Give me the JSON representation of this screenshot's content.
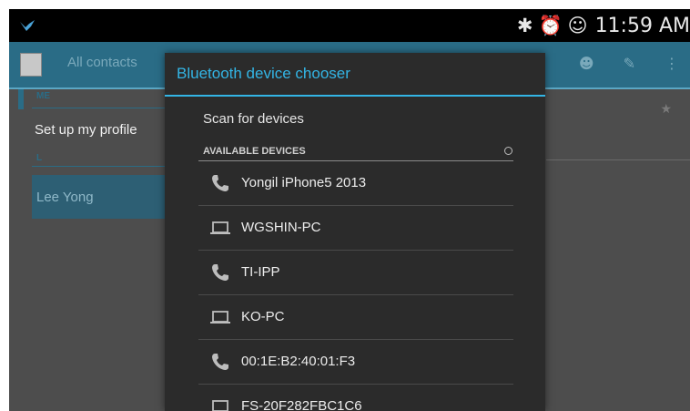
{
  "status_bar": {
    "logo_icon": "bird-logo-icon",
    "icons": [
      "bluetooth-icon",
      "alarm-icon",
      "account-sync-icon"
    ],
    "time": "11:59 AM"
  },
  "action_bar": {
    "title": "All contacts",
    "icons": [
      "contact-icon",
      "edit-icon",
      "overflow-menu-icon"
    ]
  },
  "contacts": {
    "section_me": "ME",
    "profile_label": "Set up my profile",
    "section_l": "L",
    "contact_name": "Lee Yong"
  },
  "dialog": {
    "title": "Bluetooth device chooser",
    "scan_label": "Scan for devices",
    "available_label": "AVAILABLE DEVICES",
    "accent_color": "#33b5e5",
    "devices": [
      {
        "name": "Yongil iPhone5 2013",
        "icon": "phone-icon"
      },
      {
        "name": "WGSHIN-PC",
        "icon": "laptop-icon"
      },
      {
        "name": "TI-IPP",
        "icon": "phone-icon"
      },
      {
        "name": "KO-PC",
        "icon": "laptop-icon"
      },
      {
        "name": "00:1E:B2:40:01:F3",
        "icon": "phone-icon"
      },
      {
        "name": "FS-20F282FBC1C6",
        "icon": "laptop-icon"
      }
    ]
  }
}
